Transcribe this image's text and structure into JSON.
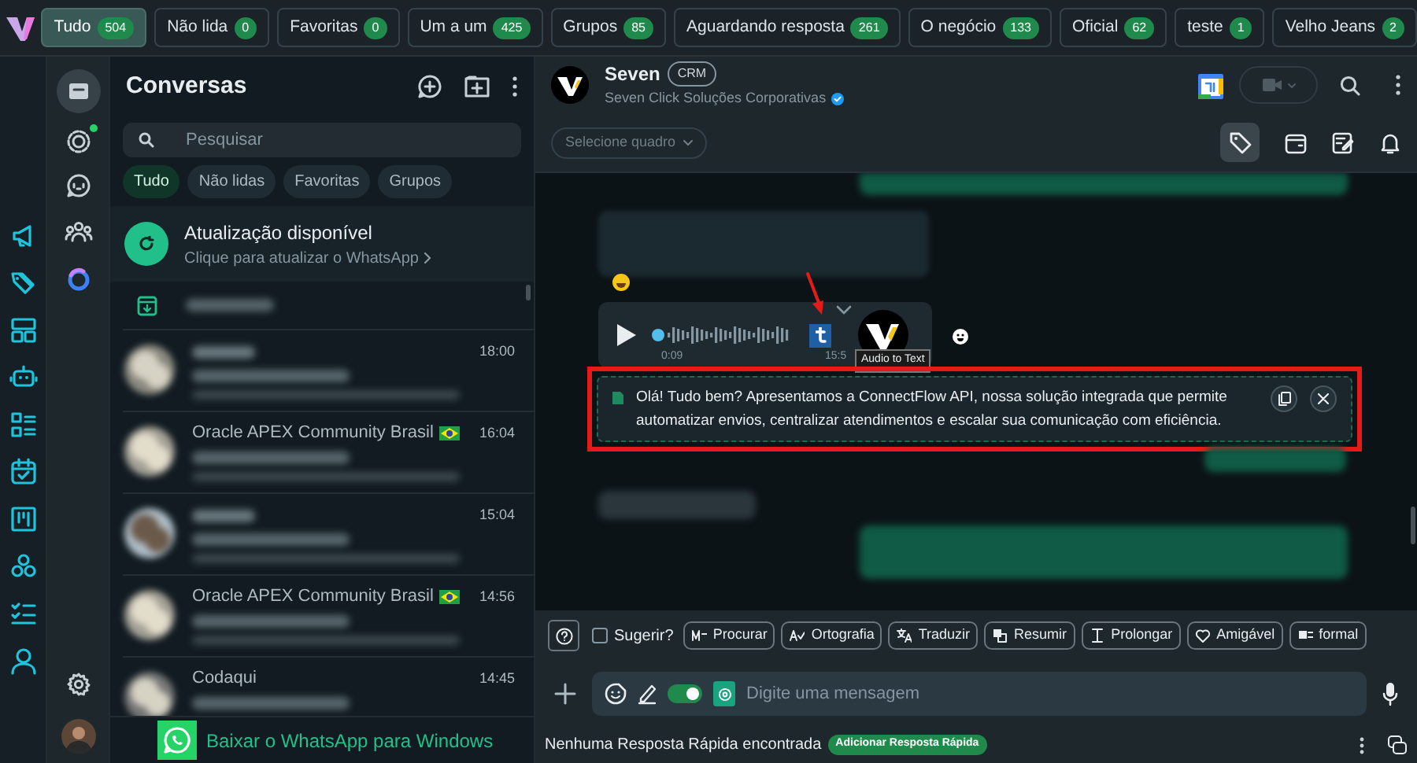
{
  "filter_tabs": [
    {
      "label": "Tudo",
      "count": "504",
      "selected": true
    },
    {
      "label": "Não lida",
      "count": "0",
      "selected": false
    },
    {
      "label": "Favoritas",
      "count": "0",
      "selected": false
    },
    {
      "label": "Um a um",
      "count": "425",
      "selected": false
    },
    {
      "label": "Grupos",
      "count": "85",
      "selected": false
    },
    {
      "label": "Aguardando resposta",
      "count": "261",
      "selected": false
    },
    {
      "label": "O negócio",
      "count": "133",
      "selected": false
    },
    {
      "label": "Oficial",
      "count": "62",
      "selected": false
    },
    {
      "label": "teste",
      "count": "1",
      "selected": false
    },
    {
      "label": "Velho Jeans",
      "count": "2",
      "selected": false
    }
  ],
  "conversations": {
    "title": "Conversas",
    "search": {
      "placeholder": "Pesquisar"
    },
    "chips": [
      {
        "label": "Tudo",
        "selected": true
      },
      {
        "label": "Não lidas",
        "selected": false
      },
      {
        "label": "Favoritas",
        "selected": false
      },
      {
        "label": "Grupos",
        "selected": false
      }
    ],
    "update": {
      "title": "Atualização disponível",
      "subtitle": "Clique para atualizar o WhatsApp"
    },
    "rows": [
      {
        "time": "18:00",
        "flag": false
      },
      {
        "name": "Oracle APEX Community Brasil",
        "time": "16:04",
        "flag": true
      },
      {
        "time": "15:04",
        "flag": false
      },
      {
        "name": "Oracle APEX Community Brasil",
        "time": "14:56",
        "flag": true
      },
      {
        "name": "Codaqui",
        "time": "14:45",
        "flag": false
      }
    ],
    "download_banner": "Baixar o WhatsApp para Windows"
  },
  "chat": {
    "name": "Seven",
    "tag": "CRM",
    "subtitle": "Seven Click Soluções Corporativas",
    "verified": true,
    "board_select": "Selecione quadro",
    "audio": {
      "elapsed": "0:09",
      "time": "15:5",
      "tooltip": "Audio to Text"
    },
    "transcript": "Olá! Tudo bem? Apresentamos a ConnectFlow API, nossa solução integrada que permite automatizar envios, centralizar atendimentos e escalar sua comunicação com eficiência."
  },
  "ai_tools": {
    "suggest": {
      "label": "Sugerir?",
      "checked": false
    },
    "buttons": [
      "Procurar",
      "Ortografia",
      "Traduzir",
      "Resumir",
      "Prolongar",
      "Amigável",
      "formal"
    ]
  },
  "composer": {
    "placeholder": "Digite uma mensagem",
    "toggle_on": true
  },
  "footer": {
    "text": "Nenhuma Resposta Rápida encontrada",
    "button": "Adicionar Resposta Rápida"
  }
}
